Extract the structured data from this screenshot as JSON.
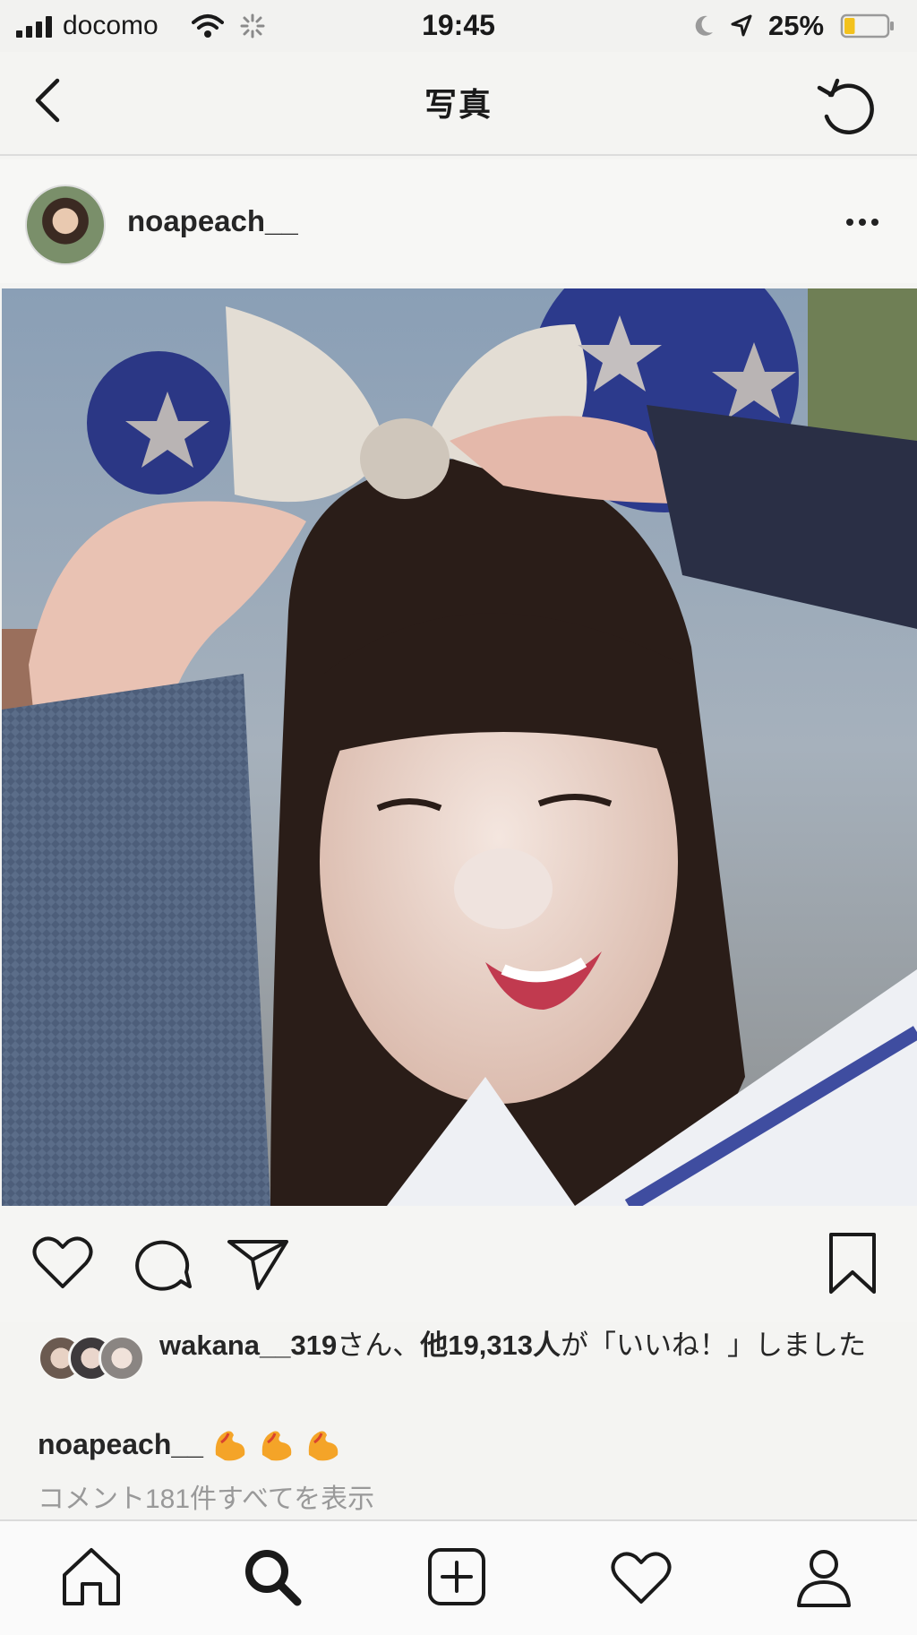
{
  "status_bar": {
    "carrier": "docomo",
    "time": "19:45",
    "battery_percent": "25%",
    "battery_level": 0.25,
    "icons": [
      "signal-icon",
      "wifi-icon",
      "activity-spinner-icon",
      "moon-icon",
      "location-arrow-icon",
      "battery-icon"
    ]
  },
  "nav": {
    "title": "写真",
    "icons": [
      "back-chevron-icon",
      "refresh-icon"
    ]
  },
  "post": {
    "username": "noapeach__",
    "icons": [
      "more-options-icon"
    ],
    "photo_label": "post-photo"
  },
  "actions": {
    "icons": [
      "heart-icon",
      "comment-bubble-icon",
      "send-paper-plane-icon",
      "bookmark-icon"
    ]
  },
  "likes": {
    "user": "wakana__319",
    "san": "さん、",
    "count_text": "他19,313人",
    "suffix": "が「いいね！」しました"
  },
  "caption": {
    "username": "noapeach__",
    "emoji": [
      "flexed-biceps-emoji",
      "flexed-biceps-emoji",
      "flexed-biceps-emoji"
    ]
  },
  "comments_link": "コメント181件すべてを表示",
  "tab_bar": {
    "icons": [
      "home-icon",
      "search-icon",
      "add-post-icon",
      "activity-heart-icon",
      "profile-icon"
    ]
  },
  "colors": {
    "battery_fill": "#f3c21d",
    "text_primary": "#262626",
    "text_secondary": "#999999"
  }
}
